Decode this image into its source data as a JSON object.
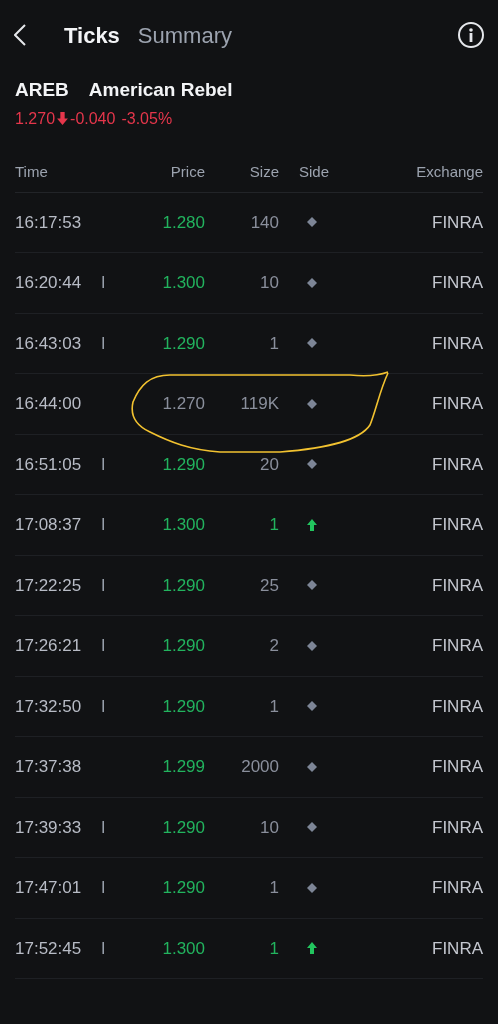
{
  "tabs": [
    {
      "label": "Ticks",
      "selected": true
    },
    {
      "label": "Summary",
      "selected": false
    }
  ],
  "stock": {
    "symbol": "AREB",
    "name": "American Rebel",
    "price": "1.270",
    "falling": true,
    "change": "-0.040",
    "change_pct": "-3.05%"
  },
  "table": {
    "columns": [
      "Time",
      "Price",
      "Size",
      "Side",
      "Exchange"
    ],
    "rows": [
      {
        "time": "16:17:53",
        "price": "1.280",
        "price_up": true,
        "size": "140",
        "uptick": false,
        "exchange": "FINRA"
      },
      {
        "time": "16:20:44",
        "flag": "I",
        "price": "1.300",
        "price_up": true,
        "size": "10",
        "uptick": false,
        "exchange": "FINRA"
      },
      {
        "time": "16:43:03",
        "flag": "I",
        "price": "1.290",
        "price_up": true,
        "size": "1",
        "uptick": false,
        "exchange": "FINRA"
      },
      {
        "time": "16:44:00",
        "price": "1.270",
        "price_up": false,
        "size": "119K",
        "uptick": false,
        "exchange": "FINRA"
      },
      {
        "time": "16:51:05",
        "flag": "I",
        "price": "1.290",
        "price_up": true,
        "size": "20",
        "uptick": false,
        "exchange": "FINRA"
      },
      {
        "time": "17:08:37",
        "flag": "I",
        "price": "1.300",
        "price_up": true,
        "size": "1",
        "uptick": true,
        "exchange": "FINRA"
      },
      {
        "time": "17:22:25",
        "flag": "I",
        "price": "1.290",
        "price_up": true,
        "size": "25",
        "uptick": false,
        "exchange": "FINRA"
      },
      {
        "time": "17:26:21",
        "flag": "I",
        "price": "1.290",
        "price_up": true,
        "size": "2",
        "uptick": false,
        "exchange": "FINRA"
      },
      {
        "time": "17:32:50",
        "flag": "I",
        "price": "1.290",
        "price_up": true,
        "size": "1",
        "uptick": false,
        "exchange": "FINRA"
      },
      {
        "time": "17:37:38",
        "price": "1.299",
        "price_up": true,
        "size": "2000",
        "uptick": false,
        "exchange": "FINRA"
      },
      {
        "time": "17:39:33",
        "flag": "I",
        "price": "1.290",
        "price_up": true,
        "size": "10",
        "uptick": false,
        "exchange": "FINRA"
      },
      {
        "time": "17:47:01",
        "flag": "I",
        "price": "1.290",
        "price_up": true,
        "size": "1",
        "uptick": false,
        "exchange": "FINRA"
      },
      {
        "time": "17:52:45",
        "flag": "I",
        "price": "1.300",
        "price_up": true,
        "size": "1",
        "uptick": true,
        "exchange": "FINRA"
      }
    ]
  }
}
